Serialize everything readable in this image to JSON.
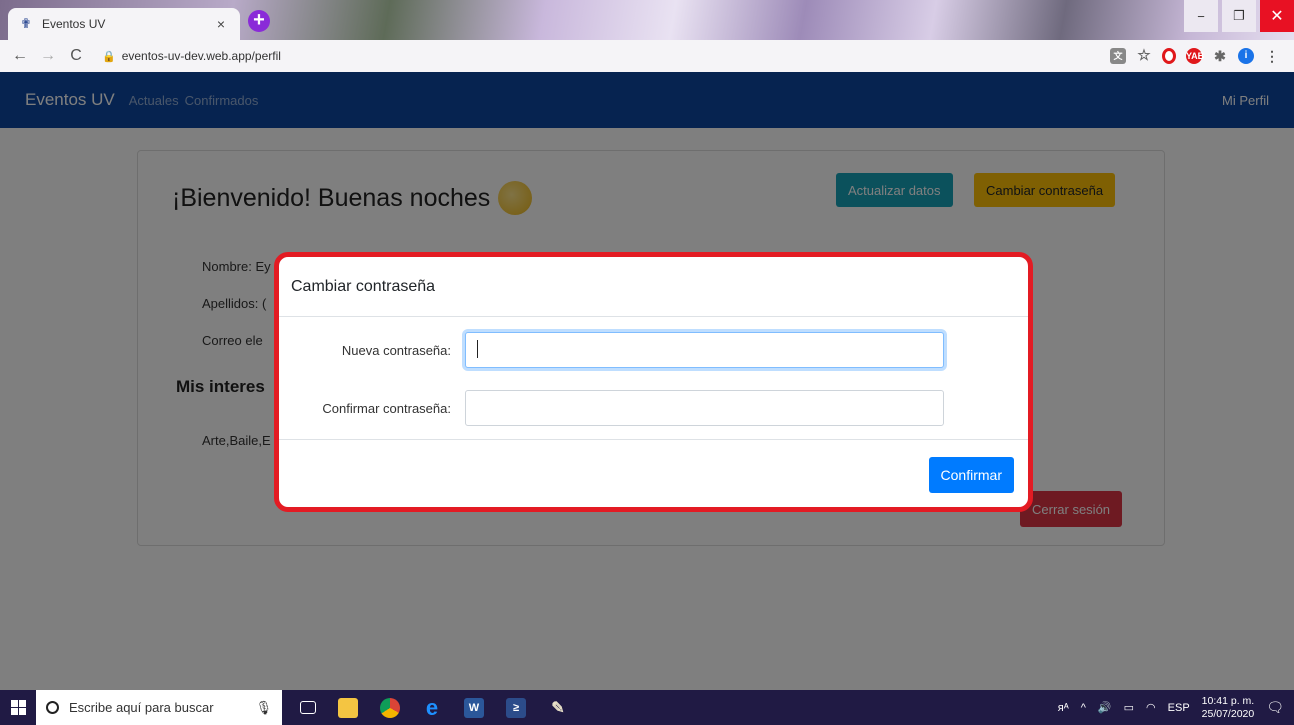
{
  "browser": {
    "tab_title": "Eventos UV",
    "tab_close": "×",
    "new_tab": "+",
    "url": "eventos-uv-dev.web.app/perfil",
    "controls": {
      "minimize": "−",
      "restore": "❐",
      "close": "✕"
    },
    "nav": {
      "back": "←",
      "forward": "→",
      "reload": "C"
    },
    "icons": [
      "lock-icon",
      "translate-icon",
      "star-icon",
      "opera-icon",
      "adblock-icon",
      "puzzle-icon",
      "profile-icon",
      "menu-icon"
    ],
    "extensions": {
      "adblock": "YAB",
      "profile": "i"
    }
  },
  "app": {
    "brand": "Eventos UV",
    "nav_links": [
      "Actuales",
      "Confirmados"
    ],
    "profile_link": "Mi Perfil",
    "colors": {
      "navbar": "#0d47a1",
      "info": "#17a2b8",
      "warning": "#ffc107",
      "danger": "#dc3545",
      "primary": "#007bff",
      "highlight": "#e31b23"
    }
  },
  "profile": {
    "greeting": "¡Bienvenido! Buenas noches",
    "update_button": "Actualizar datos",
    "change_password_button": "Cambiar contraseña",
    "fields": {
      "name": "Nombre: Ey",
      "surname": "Apellidos: (",
      "email": "Correo ele"
    },
    "interests_title": "Mis interes",
    "interests": "Arte,Baile,E",
    "logout_button": "Cerrar sesión"
  },
  "modal": {
    "title": "Cambiar contraseña",
    "new_password_label": "Nueva contraseña:",
    "new_password_value": "",
    "confirm_password_label": "Confirmar contraseña:",
    "confirm_password_value": "",
    "confirm_button": "Confirmar"
  },
  "taskbar": {
    "search_placeholder": "Escribe aquí para buscar",
    "apps": [
      "task-view",
      "file-explorer",
      "chrome",
      "edge",
      "word",
      "powershell",
      "paint"
    ],
    "app_glyphs": {
      "edge": "e",
      "word": "W",
      "powershell": "≥",
      "paint": "✎"
    },
    "tray": {
      "people": "ᴙᴬ",
      "chevron": "^",
      "volume": "🔊",
      "battery": "▭",
      "wifi": "◠",
      "language": "ESP"
    },
    "time": "10:41 p. m.",
    "date": "25/07/2020"
  }
}
